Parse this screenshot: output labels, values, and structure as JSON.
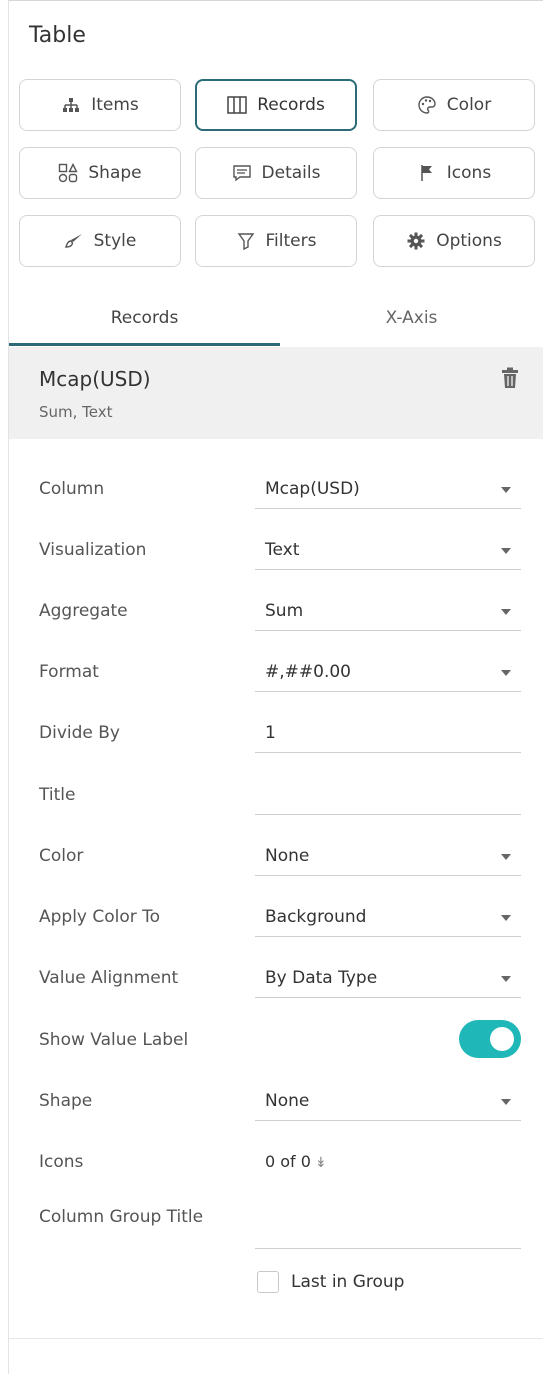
{
  "panel": {
    "title": "Table"
  },
  "toolbar": {
    "items": "Items",
    "records": "Records",
    "color": "Color",
    "shape": "Shape",
    "details": "Details",
    "icons": "Icons",
    "style": "Style",
    "filters": "Filters",
    "options": "Options"
  },
  "tabs": {
    "records": "Records",
    "xaxis": "X-Axis"
  },
  "record": {
    "name": "Mcap(USD)",
    "summary": "Sum, Text"
  },
  "fields": {
    "column": {
      "label": "Column",
      "value": "Mcap(USD)"
    },
    "visualization": {
      "label": "Visualization",
      "value": "Text"
    },
    "aggregate": {
      "label": "Aggregate",
      "value": "Sum"
    },
    "format": {
      "label": "Format",
      "value": "#,##0.00"
    },
    "divide_by": {
      "label": "Divide By",
      "value": "1"
    },
    "title": {
      "label": "Title",
      "value": ""
    },
    "color": {
      "label": "Color",
      "value": "None"
    },
    "apply_color_to": {
      "label": "Apply Color To",
      "value": "Background"
    },
    "value_alignment": {
      "label": "Value Alignment",
      "value": "By Data Type"
    },
    "show_value_label": {
      "label": "Show Value Label",
      "on": true
    },
    "shape": {
      "label": "Shape",
      "value": "None"
    },
    "icons": {
      "label": "Icons",
      "value": "0 of 0"
    },
    "column_group_title": {
      "label": "Column Group Title",
      "value": ""
    },
    "last_in_group": {
      "label": "Last in Group",
      "checked": false
    }
  },
  "colors": {
    "accent": "#2b6b78",
    "toggle": "#1fb7b7"
  }
}
